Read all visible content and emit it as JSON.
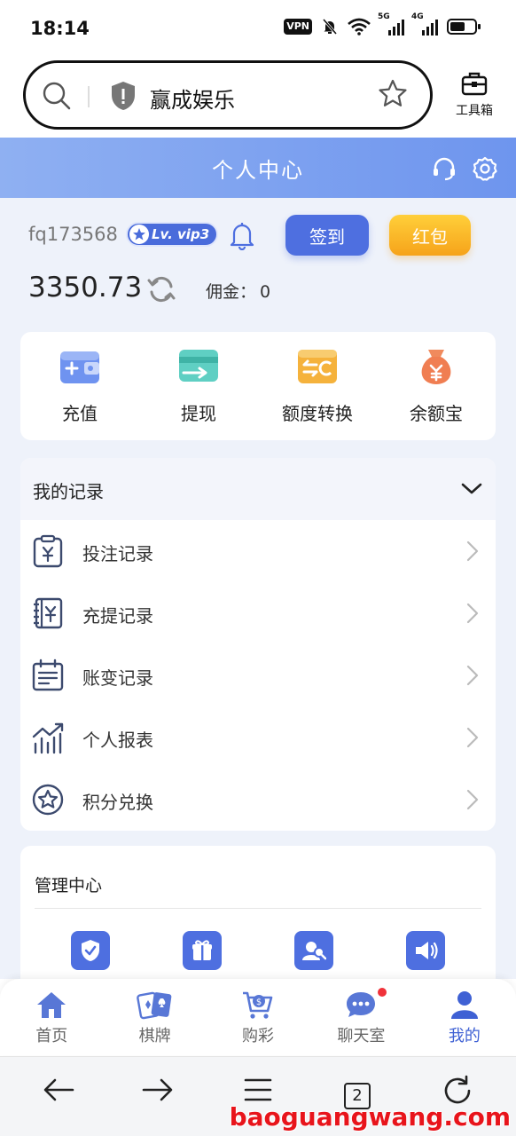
{
  "status_bar": {
    "time": "18:14",
    "vpn": "VPN",
    "sim1": "5G",
    "sim2": "4G"
  },
  "browser": {
    "url_text": "赢成娱乐",
    "toolbox_label": "工具箱",
    "tab_count": "2"
  },
  "header": {
    "title": "个人中心"
  },
  "profile": {
    "username": "fq173568",
    "vip_label": "Lv. vip3",
    "sign_in_label": "签到",
    "red_packet_label": "红包",
    "balance": "3350.73",
    "commission_label": "佣金：",
    "commission_value": "0"
  },
  "quick_actions": [
    {
      "label": "充值",
      "icon": "wallet-plus-icon"
    },
    {
      "label": "提现",
      "icon": "card-withdraw-icon"
    },
    {
      "label": "额度转换",
      "icon": "transfer-icon"
    },
    {
      "label": "余额宝",
      "icon": "money-bag-icon"
    }
  ],
  "records": {
    "title": "我的记录",
    "items": [
      {
        "label": "投注记录",
        "icon": "bet-clipboard-icon"
      },
      {
        "label": "充提记录",
        "icon": "ledger-book-icon"
      },
      {
        "label": "账变记录",
        "icon": "calendar-list-icon"
      },
      {
        "label": "个人报表",
        "icon": "trend-chart-icon"
      },
      {
        "label": "积分兑换",
        "icon": "star-circle-icon"
      }
    ]
  },
  "management": {
    "title": "管理中心"
  },
  "bottom_nav": [
    {
      "label": "首页",
      "icon": "home-icon"
    },
    {
      "label": "棋牌",
      "icon": "cards-icon"
    },
    {
      "label": "购彩",
      "icon": "cart-icon"
    },
    {
      "label": "聊天室",
      "icon": "chat-icon"
    },
    {
      "label": "我的",
      "icon": "user-icon"
    }
  ],
  "watermark": "baoguangwang.com",
  "colors": {
    "primary": "#4e6fe0",
    "header_gradient_start": "#8fb0f2",
    "header_gradient_end": "#6e95ee",
    "red_packet": "#f6a31a",
    "badge_dot": "#f0323a"
  }
}
